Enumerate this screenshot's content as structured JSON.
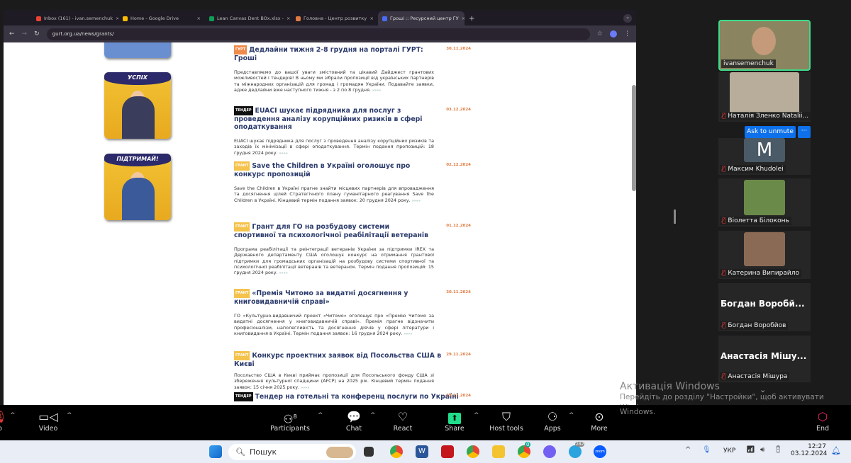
{
  "browser": {
    "tabs": [
      {
        "label": "Inbox (161) - ivan.semenchuk",
        "color": "#ea4335"
      },
      {
        "label": "Home - Google Drive",
        "color": "#fbbc04"
      },
      {
        "label": "Lean Canvas Dent BOx.xlsx -",
        "color": "#0f9d58"
      },
      {
        "label": "Головна - Центр розвитку",
        "color": "#e07a40"
      },
      {
        "label": "Гроші :: Ресурсний центр ГУ",
        "color": "#4a6cf7"
      }
    ],
    "new_tab": "+",
    "url": "gurt.org.ua/news/grants/"
  },
  "posters": [
    "УСПІХ",
    "ПІДТРИМАЙ!"
  ],
  "articles": [
    {
      "badge": "ГУРТ",
      "badge_class": "gurt",
      "title": "Дедлайни тижня 2-8 грудня на порталі ГУРТ: Гроші",
      "date": "30.11.2024",
      "text": "Представляємо до вашої уваги змістовний та цікавий Дайджест грантових можливостей і тендерів! В ньому ми зібрали пропозиції від українських партнерів та міжнародних організацій для громад і громадян України. Подавайте заявки, адже дедлайни вже наступного тижня - з 2 по 8 грудня.",
      "more": "»»»»"
    },
    {
      "badge": "ТЕНДЕР",
      "badge_class": "tender",
      "title": "EUACI шукає підрядника для послуг з проведення аналізу корупційних ризиків в сфері оподаткування",
      "date": "03.12.2024",
      "text": "EUACI шукає підрядника для послуг з проведення аналізу корупційних ризиків та заходів їх мінімізації в сфері оподаткування. Термін подання пропозицій: 18 грудня 2024 року.",
      "more": "»»»»"
    },
    {
      "badge": "ГРАНТ",
      "badge_class": "grant",
      "title": "Save the Children в Україні оголошує про конкурс пропозицій",
      "date": "02.12.2024",
      "text": "Save the Children в Україні прагне знайти місцевих партнерів для впровадження та досягнення цілей Стратегічного плану гуманітарного реагування Save the Children в Україні. Кінцевий термін подання заявок: 20 грудня 2024 року.",
      "more": "»»»»"
    },
    {
      "badge": "ГРАНТ",
      "badge_class": "grant",
      "title": "Грант для ГО на розбудову системи спортивної та психологічної реабілітації ветеранів",
      "date": "01.12.2024",
      "text": "Програма реабілітації та реінтеграції ветеранів України за підтримки IREX та Державного департаменту США оголошує конкурс на отримання грантової підтримки для громадських організацій на розбудову системи спортивної та психологічної реабілітації ветеранів та ветеранок. Термін подання пропозицій: 15 грудня 2024 року.",
      "more": "»»»»"
    },
    {
      "badge": "ГРАНТ",
      "badge_class": "grant",
      "title": "«Премія Читомо за видатні досягнення у книговидавничій справі»",
      "date": "30.11.2024",
      "text": "ГО «Культурно-видавничий проект «Читомо» оголошує про «Премію Читомо за видатні досягнення у книговидавничій справі». Премія прагне відзначити професіоналізм, наполегливість та досягнення діячів у сфері літератури і книговидання в Україні. Термін подання заявок: 16 грудня 2024 року.",
      "more": "»»»»"
    },
    {
      "badge": "ГРАНТ",
      "badge_class": "grant",
      "title": "Конкурс проектних заявок від Посольства США в Києві",
      "date": "29.11.2024",
      "text": "Посольство США в Києві приймає пропозиції для Посольського фонду США зі збереження культурної спадщини (AFCP) на 2025 рік. Кінцевий термін подання заявок: 15 січня 2025 року.",
      "more": "»»»»"
    },
    {
      "badge": "ТЕНДЕР",
      "badge_class": "tender",
      "title": "Тендер на готельні та конференц послуги по Україні",
      "date": "29.11.2024",
      "text": "",
      "more": ""
    }
  ],
  "zoom": {
    "participants": [
      {
        "name": "ivansemenchuk",
        "muted": false
      },
      {
        "name": "Наталія Зленко Natalii...",
        "muted": true
      },
      {
        "name": "Максим Khudolei",
        "muted": true,
        "initial": "M"
      },
      {
        "name": "Віолетта Білоконь",
        "muted": true
      },
      {
        "name": "Катерина Випирайло",
        "muted": true
      },
      {
        "name": "Богдан Воробйов",
        "muted": true,
        "display": "Богдан Воробй..."
      },
      {
        "name": "Анастасія Мішура",
        "muted": true,
        "display": "Анастасія Мішу..."
      }
    ],
    "ask_unmute": "Ask to unmute",
    "more_dots": "···",
    "toolbar": {
      "audio": "o",
      "video": "Video",
      "participants": "Participants",
      "participants_count": "8",
      "chat": "Chat",
      "react": "React",
      "share": "Share",
      "host_tools": "Host tools",
      "apps": "Apps",
      "more": "More",
      "end": "End"
    },
    "share_color": "#1fdd8a",
    "end_color": "#e0245e"
  },
  "watermark": {
    "title": "Активація Windows",
    "text": "Перейдіть до розділу \"Настройки\", щоб активувати Windows."
  },
  "taskbar": {
    "search": "Пошук",
    "lang": "УКР",
    "time": "12:27",
    "date": "03.12.2024",
    "telegram_badge": "282",
    "chrome_badge": "0"
  }
}
